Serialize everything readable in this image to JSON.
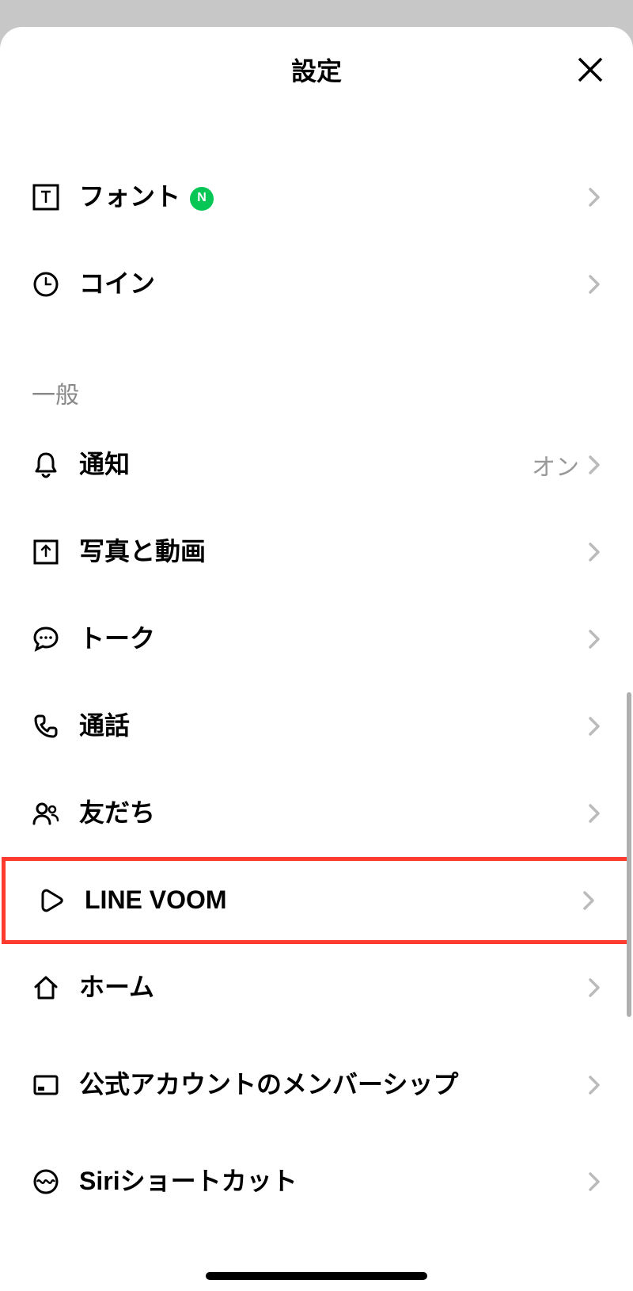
{
  "header": {
    "title": "設定"
  },
  "top_items": [
    {
      "label": "フォント",
      "has_new_badge": true
    },
    {
      "label": "コイン"
    }
  ],
  "section": {
    "header": "一般"
  },
  "items": [
    {
      "label": "通知",
      "value": "オン"
    },
    {
      "label": "写真と動画"
    },
    {
      "label": "トーク"
    },
    {
      "label": "通話"
    },
    {
      "label": "友だち"
    },
    {
      "label": "LINE VOOM"
    },
    {
      "label": "ホーム"
    },
    {
      "label": "公式アカウントのメンバーシップ"
    },
    {
      "label": "Siriショートカット"
    }
  ],
  "badge": {
    "text": "N"
  }
}
